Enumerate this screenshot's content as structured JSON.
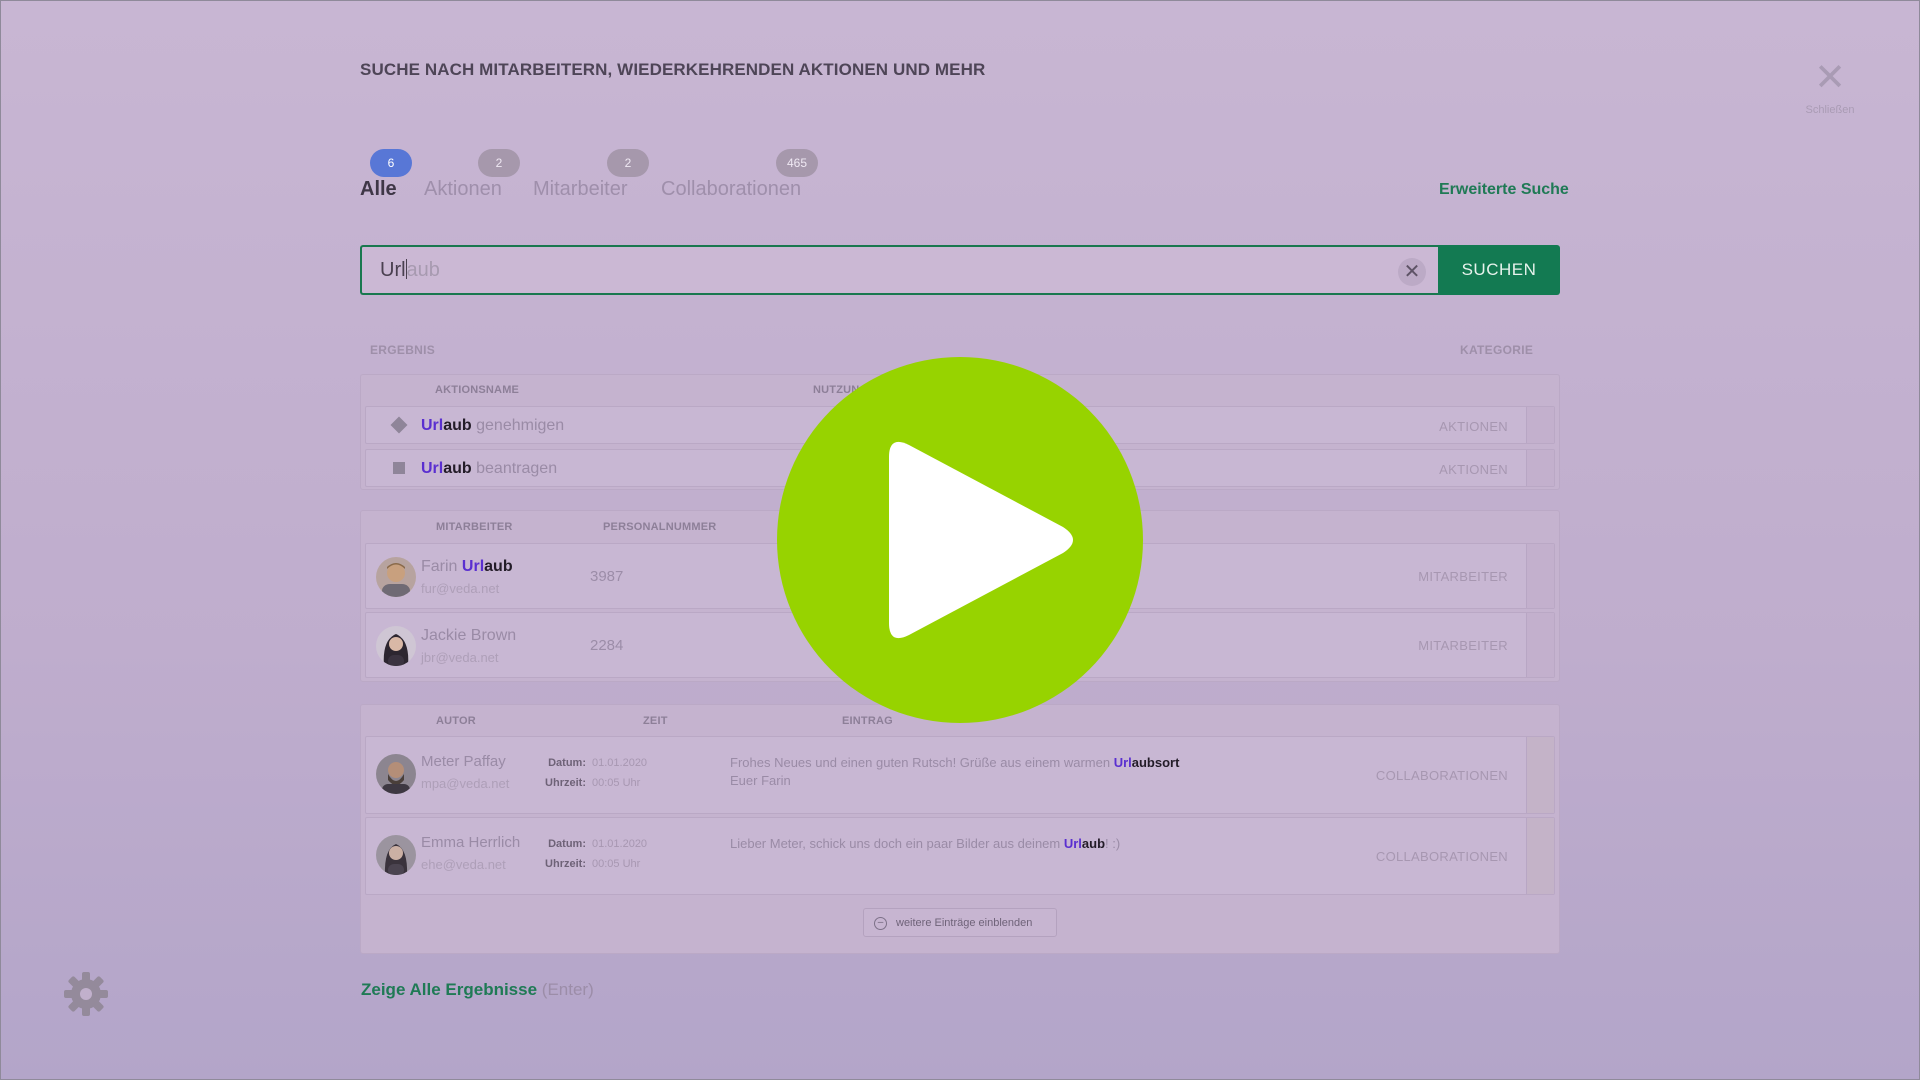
{
  "header": {
    "title": "SUCHE NACH MITARBEITERN, WIEDERKEHRENDEN AKTIONEN UND MEHR",
    "close_label": "Schließen"
  },
  "tabs": [
    {
      "label": "Alle",
      "count": "6",
      "active": true
    },
    {
      "label": "Aktionen",
      "count": "2"
    },
    {
      "label": "Mitarbeiter",
      "count": "2"
    },
    {
      "label": "Collaborationen",
      "count": "465"
    }
  ],
  "advanced_search_label": "Erweiterte Suche",
  "search": {
    "typed": "Url",
    "suggestion_rest": "aub",
    "button_label": "SUCHEN"
  },
  "results": {
    "result_header": "ERGEBNIS",
    "category_header": "KATEGORIE",
    "actions": {
      "col_name": "AKTIONSNAME",
      "col_usage": "NUTZUNG",
      "rows": [
        {
          "match": "Url",
          "match_rest": "aub",
          "rest": " genehmigen",
          "category": "AKTIONEN"
        },
        {
          "match": "Url",
          "match_rest": "aub",
          "rest": " beantragen",
          "category": "AKTIONEN"
        }
      ]
    },
    "employees": {
      "col_name": "MITARBEITER",
      "col_number": "PERSONALNUMMER",
      "rows": [
        {
          "first": "Farin ",
          "match": "Url",
          "match_rest": "aub",
          "email": "fur@veda.net",
          "number": "3987",
          "category": "MITARBEITER"
        },
        {
          "first": "Jackie  Brown",
          "match": "",
          "match_rest": "",
          "email": "jbr@veda.net",
          "number": "2284",
          "category": "MITARBEITER"
        }
      ]
    },
    "collaborations": {
      "col_author": "AUTOR",
      "col_time": "ZEIT",
      "col_entry": "EINTRAG",
      "date_label": "Datum:",
      "time_label": "Uhrzeit:",
      "rows": [
        {
          "name": "Meter Paffay",
          "email": "mpa@veda.net",
          "date": "01.01.2020",
          "time": "00:05 Uhr",
          "entry_pre": "Frohes Neues und einen guten Rutsch! Grüße aus einem warmen ",
          "match": "Url",
          "match_rest": "aubsort",
          "entry_post": "",
          "entry_line2": "Euer Farin",
          "category": "COLLABORATIONEN"
        },
        {
          "name": "Emma Herrlich",
          "email": "ehe@veda.net",
          "date": "01.01.2020",
          "time": "00:05 Uhr",
          "entry_pre": "Lieber Meter, schick uns doch ein paar Bilder aus deinem ",
          "match": "Url",
          "match_rest": "aub",
          "entry_post": "! :)",
          "entry_line2": "",
          "category": "COLLABORATIONEN"
        }
      ]
    },
    "more_label": "weitere Einträge einblenden"
  },
  "footer": {
    "show_all": "Zeige Alle Ergebnisse",
    "show_all_hint": "(Enter)"
  },
  "colors": {
    "accent_green": "#137a52",
    "badge_active": "#5877d6",
    "highlight": "#5a2fd0",
    "play_button": "#97d300"
  },
  "icons": [
    "close-icon",
    "clear-icon",
    "diamond-icon",
    "square-icon",
    "expand-icon",
    "gear-icon",
    "play-icon"
  ]
}
